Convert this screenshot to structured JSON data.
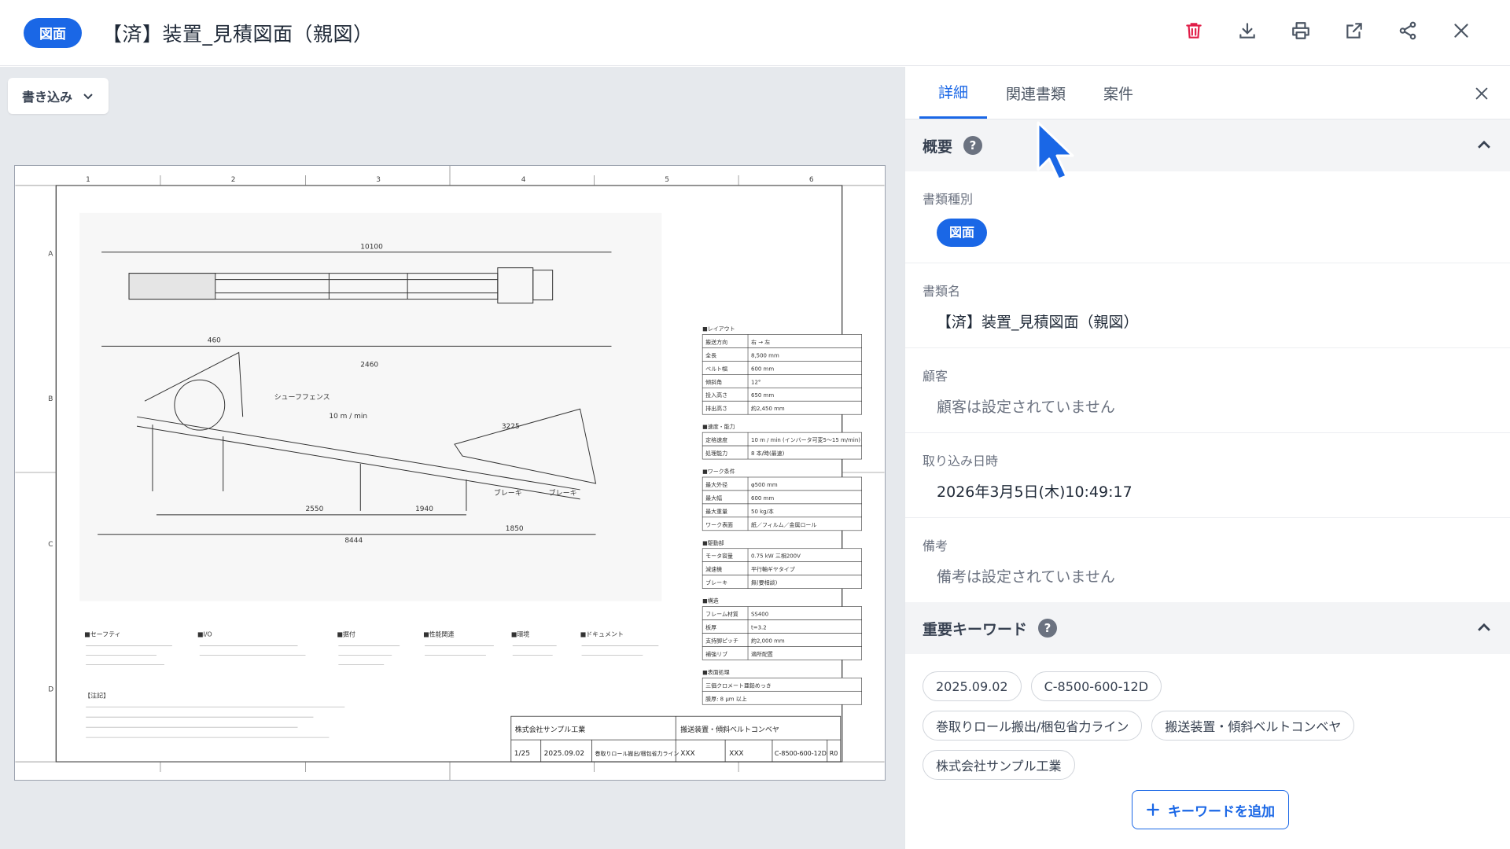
{
  "header": {
    "type_badge": "図面",
    "title": "【済】装置_見積図面（親図）",
    "actions": [
      {
        "name": "delete-icon",
        "color": "#e11d48"
      },
      {
        "name": "download-icon"
      },
      {
        "name": "print-icon"
      },
      {
        "name": "open-external-icon"
      },
      {
        "name": "share-icon"
      },
      {
        "name": "close-icon"
      }
    ]
  },
  "viewer": {
    "write_label": "書き込み"
  },
  "drawing": {
    "dim_overall": "10100",
    "dim_2460": "2460",
    "dim_8444": "8444",
    "dim_2550": "2550",
    "dim_1940": "1940",
    "dim_1850": "1850",
    "dim_3225": "3225",
    "dim_460": "460",
    "label_fence": "シューフフェンス",
    "label_speed": "10 m / min",
    "label_brake_a": "ブレーキ",
    "label_brake_b": "ブレーキ",
    "sec_layout": "■レイアウト",
    "sec_speed": "■速度・能力",
    "sec_work": "■ワーク条件",
    "sec_drive": "■駆動部",
    "sec_struct": "■構造",
    "sec_surface": "■表面処理",
    "rows_layout": [
      [
        "搬送方向",
        "右 → 左"
      ],
      [
        "全長",
        "8,500 mm"
      ],
      [
        "ベルト幅",
        "600 mm"
      ],
      [
        "傾斜角",
        "12°"
      ],
      [
        "投入高さ",
        "650 mm"
      ],
      [
        "排出高さ",
        "約2,450 mm"
      ]
    ],
    "rows_speed": [
      [
        "定格速度",
        "10 m / min (インバータ可変5〜15 m/min)"
      ],
      [
        "処理能力",
        "8 本/時(最速)"
      ]
    ],
    "rows_work": [
      [
        "最大外径",
        "φ500 mm"
      ],
      [
        "最大幅",
        "600 mm"
      ],
      [
        "最大重量",
        "50 kg/本"
      ],
      [
        "ワーク表面",
        "紙／フィルム／金属ロール"
      ]
    ],
    "rows_drive": [
      [
        "モータ容量",
        "0.75 kW 三相200V"
      ],
      [
        "減速機",
        "平行軸ギヤタイプ"
      ],
      [
        "ブレーキ",
        "無(要相談)"
      ]
    ],
    "rows_struct": [
      [
        "フレーム材質",
        "SS400"
      ],
      [
        "板厚",
        "t=3.2"
      ],
      [
        "支持脚ピッチ",
        "約2,000 mm"
      ],
      [
        "補強リブ",
        "適所配置"
      ]
    ],
    "rows_surface": [
      [
        "三価クロメート亜鉛めっき"
      ],
      [
        "膜厚: 8 µm 以上"
      ]
    ],
    "notes_heads": [
      "■セーフティ",
      "■I/O",
      "■据付",
      "■性能関連",
      "■環境",
      "■ドキュメント"
    ],
    "notes_title": "【注記】",
    "title_company": "株式会社サンプル工業",
    "title_name": "搬送装置・傾斜ベルトコンベヤ",
    "title_scale": "1/25",
    "title_date": "2025.09.02",
    "title_project": "巻取りロール搬出/梱包省力ライン",
    "title_dwg": "C-8500-600-12D",
    "title_rev": "R0",
    "title_xxx": "XXX",
    "grid_cols": [
      "1",
      "2",
      "3",
      "4",
      "5",
      "6"
    ],
    "grid_rows": [
      "A",
      "B",
      "C",
      "D"
    ]
  },
  "panel": {
    "tabs": [
      "詳細",
      "関連書類",
      "案件"
    ],
    "active_tab": 0,
    "overview_title": "概要",
    "help_glyph": "?",
    "doc_type_label": "書類種別",
    "doc_type_value": "図面",
    "doc_name_label": "書類名",
    "doc_name_value": "【済】装置_見積図面（親図）",
    "customer_label": "顧客",
    "customer_value": "顧客は設定されていません",
    "imported_label": "取り込み日時",
    "imported_value": "2026年3月5日(木)10:49:17",
    "remarks_label": "備考",
    "remarks_value": "備考は設定されていません",
    "keywords_title": "重要キーワード",
    "keywords": [
      "2025.09.02",
      "C-8500-600-12D",
      "巻取りロール搬出/梱包省力ライン",
      "搬送装置・傾斜ベルトコンベヤ",
      "株式会社サンプル工業"
    ],
    "add_keyword_label": "キーワードを追加"
  },
  "colors": {
    "primary": "#1a67e6",
    "danger": "#e11d48"
  }
}
